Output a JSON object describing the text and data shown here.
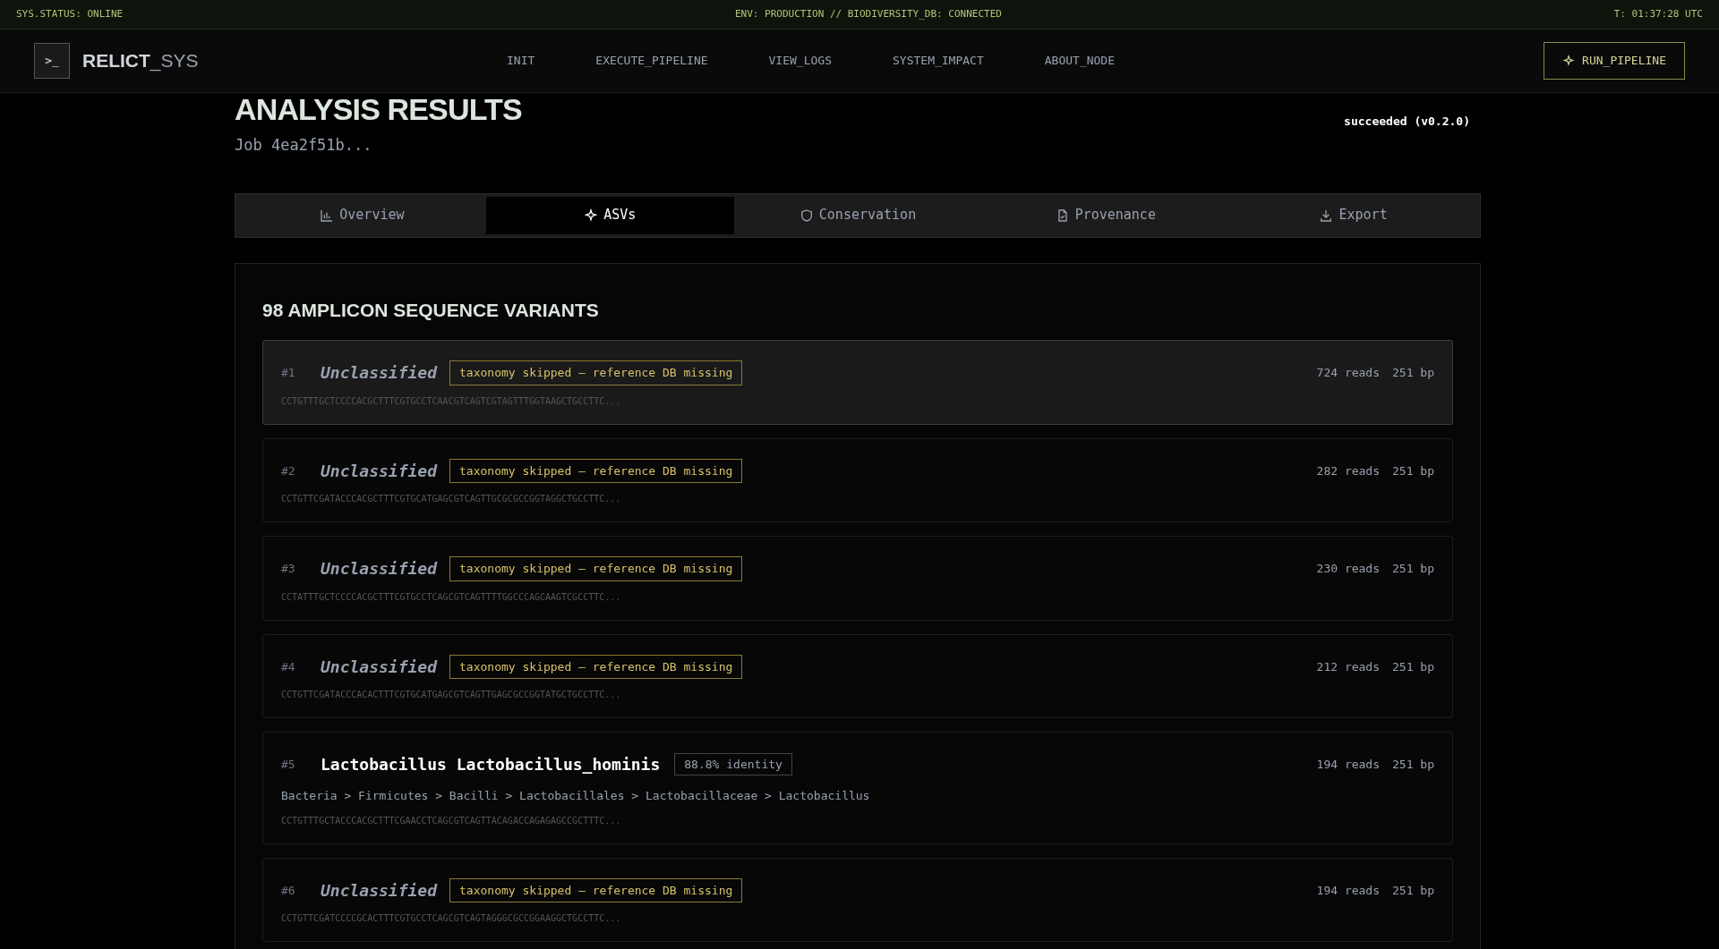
{
  "status_bar": {
    "left": "SYS.STATUS: ONLINE",
    "center": "ENV: PRODUCTION // BIODIVERSITY_DB: CONNECTED",
    "right": "T: 01:37:28 UTC"
  },
  "nav": {
    "logo_glyph": ">_",
    "brand_main": "RELICT",
    "brand_suffix": "_SYS",
    "links": [
      "INIT",
      "EXECUTE_PIPELINE",
      "VIEW_LOGS",
      "SYSTEM_IMPACT",
      "ABOUT_NODE"
    ],
    "action": "RUN_PIPELINE"
  },
  "header": {
    "title": "ANALYSIS RESULTS",
    "job": "Job 4ea2f51b...",
    "status": "succeeded (v0.2.0)"
  },
  "tabs": [
    {
      "label": "Overview",
      "selected": false
    },
    {
      "label": "ASVs",
      "selected": true
    },
    {
      "label": "Conservation",
      "selected": false
    },
    {
      "label": "Provenance",
      "selected": false
    },
    {
      "label": "Export",
      "selected": false
    }
  ],
  "asv_panel": {
    "title": "98 AMPLICON SEQUENCE VARIANTS",
    "rows": [
      {
        "kind": "unclassified",
        "hovered": true,
        "rank": "#1",
        "name": "Unclassified",
        "badge": "taxonomy skipped — reference DB missing",
        "reads": "724 reads",
        "length": "251 bp",
        "sequence": "CCTGTTTGCTCCCCACGCTTTCGTGCCTCAACGTCAGTCGTAGTTTGGTAAGCTGCCTTC..."
      },
      {
        "kind": "unclassified",
        "hovered": false,
        "rank": "#2",
        "name": "Unclassified",
        "badge": "taxonomy skipped — reference DB missing",
        "reads": "282 reads",
        "length": "251 bp",
        "sequence": "CCTGTTCGATACCCACGCTTTCGTGCATGAGCGTCAGTTGCGCGCCGGTAGGCTGCCTTC..."
      },
      {
        "kind": "unclassified",
        "hovered": false,
        "rank": "#3",
        "name": "Unclassified",
        "badge": "taxonomy skipped — reference DB missing",
        "reads": "230 reads",
        "length": "251 bp",
        "sequence": "CCTATTTGCTCCCCACGCTTTCGTGCCTCAGCGTCAGTTTTGGCCCAGCAAGTCGCCTTC..."
      },
      {
        "kind": "unclassified",
        "hovered": false,
        "rank": "#4",
        "name": "Unclassified",
        "badge": "taxonomy skipped — reference DB missing",
        "reads": "212 reads",
        "length": "251 bp",
        "sequence": "CCTGTTCGATACCCACACTTTCGTGCATGAGCGTCAGTTGAGCGCCGGTATGCTGCCTTC..."
      },
      {
        "kind": "classified",
        "hovered": false,
        "rank": "#5",
        "name": "Lactobacillus Lactobacillus_hominis",
        "badge": "88.8% identity",
        "reads": "194 reads",
        "length": "251 bp",
        "lineage": "Bacteria > Firmicutes > Bacilli > Lactobacillales > Lactobacillaceae > Lactobacillus",
        "sequence": "CCTGTTTGCTACCCACGCTTTCGAACCTCAGCGTCAGTTACAGACCAGAGAGCCGCTTTC..."
      },
      {
        "kind": "unclassified",
        "hovered": false,
        "rank": "#6",
        "name": "Unclassified",
        "badge": "taxonomy skipped — reference DB missing",
        "reads": "194 reads",
        "length": "251 bp",
        "sequence": "CCTGTTCGATCCCCGCACTTTCGTGCCTCAGCGTCAGTAGGGCGCCGGAAGGCTGCCTTC..."
      }
    ]
  }
}
